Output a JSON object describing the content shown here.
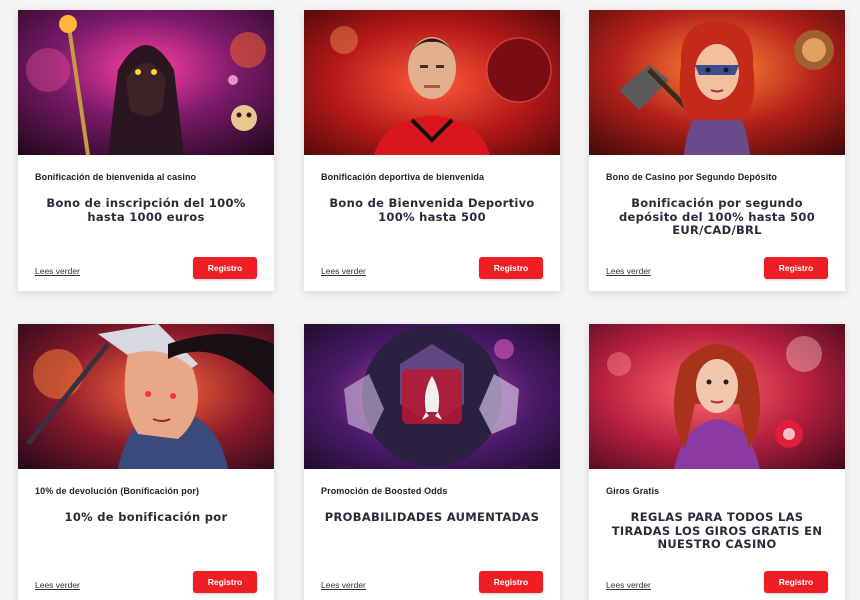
{
  "cards": [
    {
      "category": "Bonificación de bienvenida al casino",
      "headline": "Bono de inscripción del 100% hasta 1000 euros",
      "more_label": "Lees verder",
      "button_label": "Registro",
      "art": "hooded-wizard-casino-art"
    },
    {
      "category": "Bonificación deportiva de bienvenida",
      "headline": "Bono de Bienvenida Deportivo 100% hasta 500",
      "more_label": "Lees verder",
      "button_label": "Registro",
      "art": "football-player-sports-art"
    },
    {
      "category": "Bono de Casino por Segundo Depósito",
      "headline": "Bonificación por segundo depósito del 100% hasta 500 EUR/CAD/BRL",
      "more_label": "Lees verder",
      "button_label": "Registro",
      "art": "warrior-woman-casino-art"
    },
    {
      "category": "10% de devolución (Bonificación por)",
      "headline": "10% de bonificación por",
      "more_label": "Lees verder",
      "button_label": "Registro",
      "art": "armored-heroine-art"
    },
    {
      "category": "Promoción de Boosted Odds",
      "headline": "PROBABILIDADES AUMENTADAS",
      "more_label": "Lees verder",
      "button_label": "Registro",
      "art": "rocket-football-art"
    },
    {
      "category": "Giros Gratis",
      "headline": "REGLAS PARA TODOS LAS TIRADAS LOS GIROS GRATIS EN NUESTRO CASINO",
      "more_label": "Lees verder",
      "button_label": "Registro",
      "art": "red-haired-woman-art"
    }
  ],
  "colors": {
    "accent": "#ee1e24",
    "card_bg": "#ffffff",
    "page_bg": "#f4f4f4",
    "headline": "#2a2a3a"
  }
}
